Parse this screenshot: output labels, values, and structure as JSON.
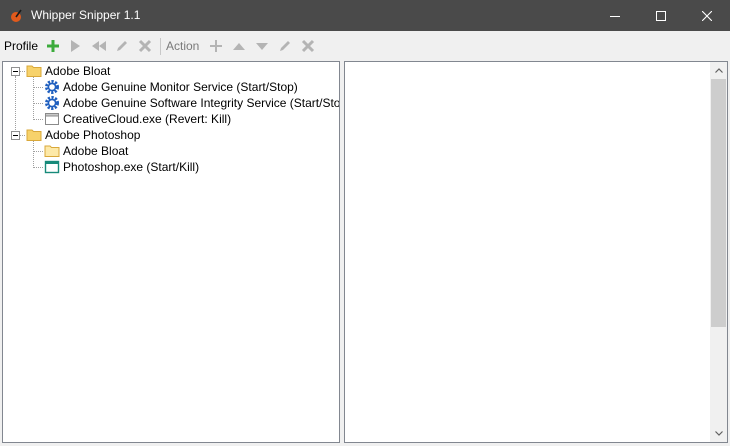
{
  "window": {
    "title": "Whipper Snipper 1.1"
  },
  "toolbar": {
    "profile_label": "Profile",
    "action_label": "Action"
  },
  "tree": {
    "profiles": [
      {
        "label": "Adobe Bloat",
        "expanded": true,
        "children": [
          {
            "label": "Adobe Genuine Monitor Service (Start/Stop)",
            "icon": "service-gear-icon"
          },
          {
            "label": "Adobe Genuine Software Integrity Service (Start/Stop)",
            "icon": "service-gear-icon"
          },
          {
            "label": "CreativeCloud.exe (Revert: Kill)",
            "icon": "window-app-icon"
          }
        ]
      },
      {
        "label": "Adobe Photoshop",
        "expanded": true,
        "children": [
          {
            "label": "Adobe Bloat",
            "icon": "folder-icon"
          },
          {
            "label": "Photoshop.exe (Start/Kill)",
            "icon": "window-app-icon-teal"
          }
        ]
      }
    ]
  },
  "colors": {
    "titlebar": "#4a4a4a",
    "add_green": "#3cab3c",
    "folder_yellow": "#f7d26b",
    "gear_blue": "#1f5fbf",
    "teal": "#178a7a",
    "disabled_gray": "#b4b4b4"
  }
}
